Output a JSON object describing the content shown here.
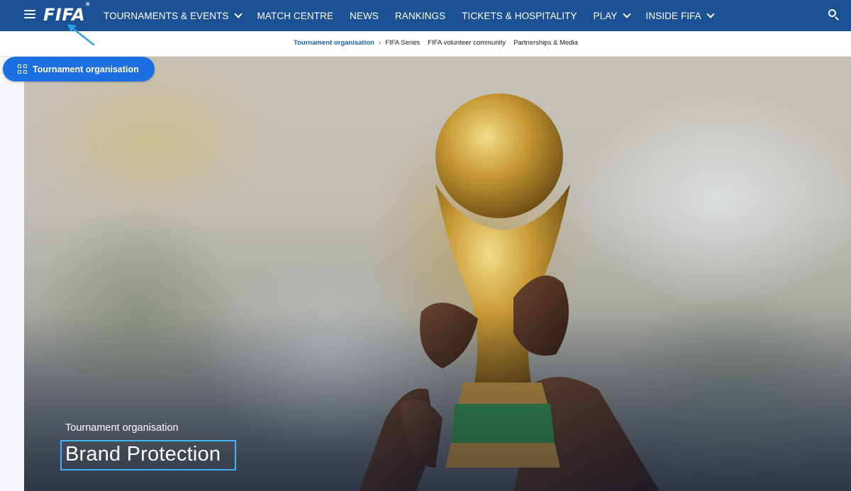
{
  "nav": {
    "logo": "FIFA",
    "logo_mark": "®",
    "items": [
      {
        "label": "TOURNAMENTS & EVENTS",
        "has_dropdown": true
      },
      {
        "label": "MATCH CENTRE",
        "has_dropdown": false
      },
      {
        "label": "NEWS",
        "has_dropdown": false
      },
      {
        "label": "RANKINGS",
        "has_dropdown": false
      },
      {
        "label": "TICKETS & HOSPITALITY",
        "has_dropdown": false
      },
      {
        "label": "PLAY",
        "has_dropdown": true
      },
      {
        "label": "INSIDE FIFA",
        "has_dropdown": true
      }
    ],
    "background": "#1d5196"
  },
  "subnav": {
    "items": [
      {
        "label": "Tournament organisation",
        "active": true
      },
      {
        "label": "FIFA Series",
        "active": false
      },
      {
        "label": "FIFA volunteer community",
        "active": false
      },
      {
        "label": "Partnerships & Media",
        "active": false
      }
    ],
    "separator": "›"
  },
  "floating_button": {
    "label": "Tournament organisation",
    "color": "#1d6ee0"
  },
  "hero": {
    "kicker": "Tournament organisation",
    "title": "Brand Protection",
    "highlight_color": "#3db0ff"
  },
  "icons": [
    "hamburger-icon",
    "search-icon",
    "chevron-down-icon",
    "grid-icon"
  ]
}
